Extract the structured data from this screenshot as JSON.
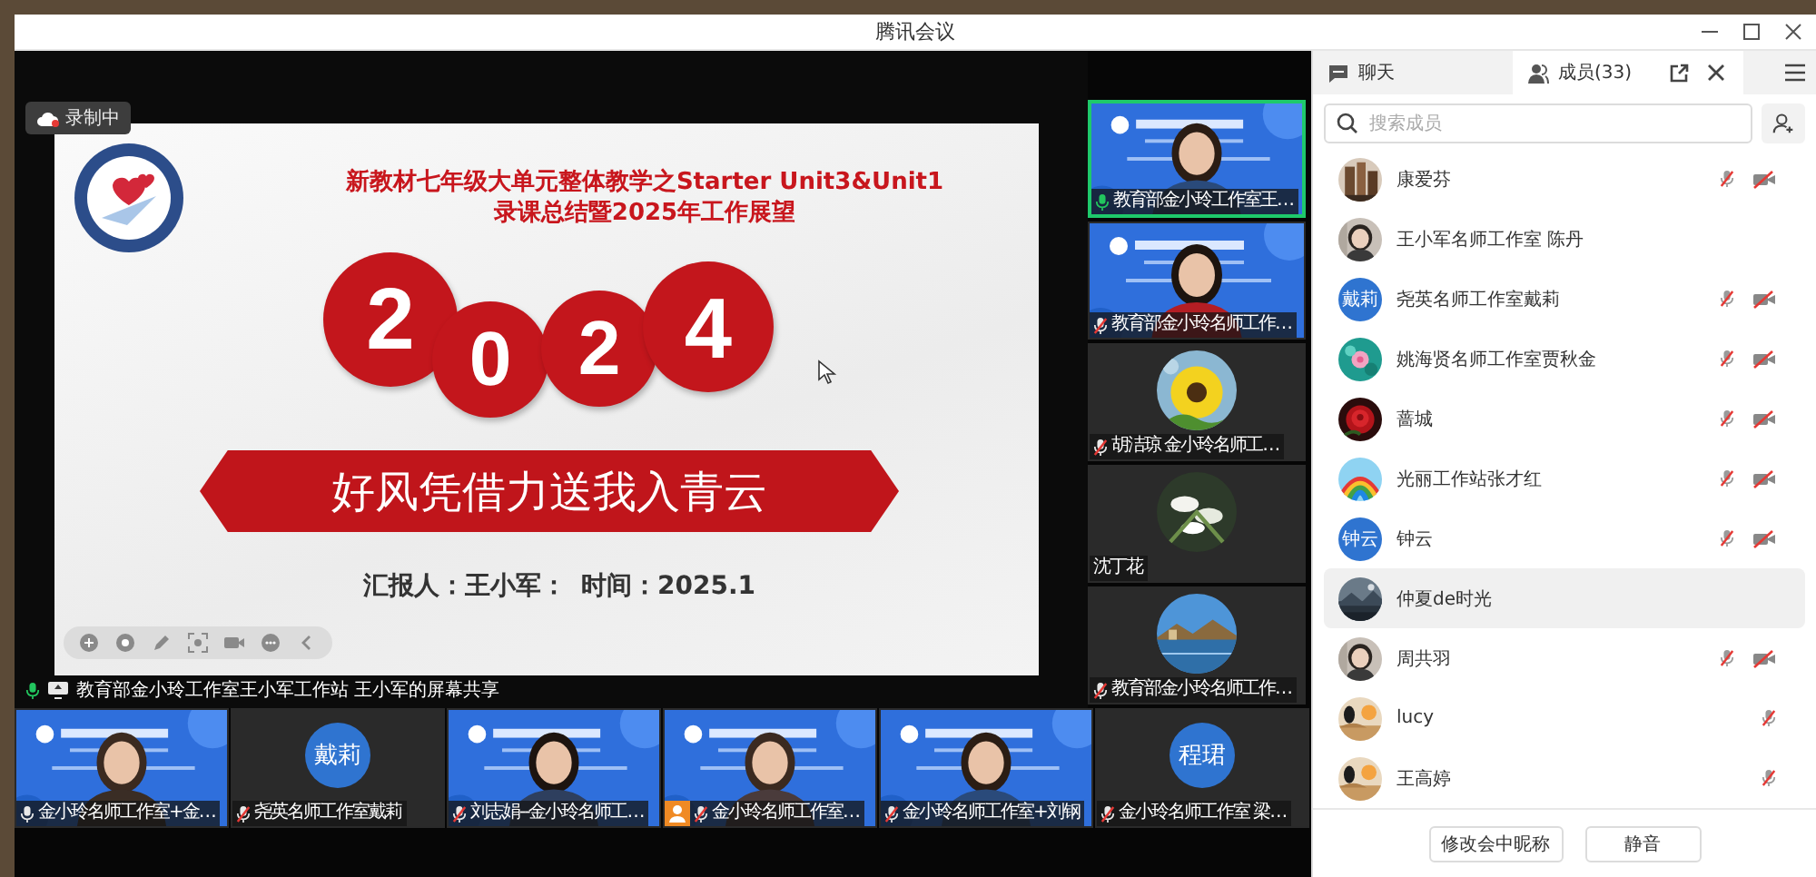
{
  "window": {
    "title": "腾讯会议"
  },
  "recording_badge": {
    "label": "录制中"
  },
  "slide": {
    "title_lines": [
      "新教材七年级大单元整体教学之Starter Unit3&Unit1",
      "录课总结暨2025年工作展望"
    ],
    "year_digits": [
      "2",
      "0",
      "2",
      "4"
    ],
    "banner": "好风凭借力送我入青云",
    "reporter": "汇报人：王小军：",
    "time": "时间：2025.1"
  },
  "share_caption": "教育部金小玲工作室王小军工作站 王小军的屏幕共享",
  "side_tiles": [
    {
      "kind": "video",
      "name": "教育部金小玲工作室王…",
      "has_mic": true,
      "mic_muted": false,
      "active": true,
      "host": false
    },
    {
      "kind": "video",
      "name": "教育部金小玲名师工作…",
      "has_mic": true,
      "mic_muted": true,
      "active": false,
      "host": false
    },
    {
      "kind": "avatar_picture",
      "name": "胡洁琼 金小玲名师工…",
      "has_mic": true,
      "mic_muted": true,
      "active": false,
      "host": false
    },
    {
      "kind": "avatar_picture",
      "name": "沈丁花",
      "has_mic": false,
      "active": false,
      "host": false
    },
    {
      "kind": "avatar_picture",
      "name": "教育部金小玲名师工作…",
      "has_mic": true,
      "mic_muted": true,
      "active": false,
      "host": false
    }
  ],
  "bottom_tiles": [
    {
      "kind": "video",
      "name": "金小玲名师工作室+金…",
      "has_mic": true,
      "mic_muted": false,
      "active": false,
      "host": false
    },
    {
      "kind": "avatar_text",
      "avatar_text": "戴莉",
      "name": "尧英名师工作室戴莉",
      "has_mic": true,
      "mic_muted": true,
      "active": false,
      "host": false
    },
    {
      "kind": "video",
      "name": "刘志娟--金小玲名师工…",
      "has_mic": true,
      "mic_muted": true,
      "active": false,
      "host": false
    },
    {
      "kind": "video",
      "name": "金小玲名师工作室…",
      "has_mic": true,
      "mic_muted": true,
      "active": false,
      "host": true
    },
    {
      "kind": "video",
      "name": "金小玲名师工作室+刘钢",
      "has_mic": true,
      "mic_muted": true,
      "active": false,
      "host": false
    },
    {
      "kind": "avatar_text",
      "avatar_text": "程珺",
      "name": "金小玲名师工作室 梁…",
      "has_mic": true,
      "mic_muted": true,
      "active": false,
      "host": false
    }
  ],
  "panel": {
    "tabs": [
      {
        "label": "聊天",
        "selected": false
      },
      {
        "label": "成员(33)",
        "selected": true
      }
    ],
    "search": {
      "placeholder": "搜索成员"
    },
    "members": [
      {
        "kind": "picture",
        "name": "康爱芬",
        "mic_muted": true,
        "camera_off": true,
        "selected": false
      },
      {
        "kind": "picture",
        "name": "王小军名师工作室 陈丹",
        "mic_muted": false,
        "camera_off": false,
        "selected": false
      },
      {
        "kind": "text",
        "avatar_text": "戴莉",
        "name": "尧英名师工作室戴莉",
        "mic_muted": true,
        "camera_off": true,
        "selected": false
      },
      {
        "kind": "picture",
        "name": "姚海贤名师工作室贾秋金",
        "mic_muted": true,
        "camera_off": true,
        "selected": false
      },
      {
        "kind": "picture",
        "name": "蔷城",
        "mic_muted": true,
        "camera_off": true,
        "selected": false
      },
      {
        "kind": "picture",
        "name": "光丽工作站张才红",
        "mic_muted": true,
        "camera_off": true,
        "selected": false
      },
      {
        "kind": "text",
        "avatar_text": "钟云",
        "name": "钟云",
        "mic_muted": true,
        "camera_off": true,
        "selected": false
      },
      {
        "kind": "picture",
        "name": "仲夏de时光",
        "mic_muted": false,
        "camera_off": false,
        "selected": true
      },
      {
        "kind": "picture",
        "name": "周共羽",
        "mic_muted": true,
        "camera_off": true,
        "selected": false
      },
      {
        "kind": "picture",
        "name": "lucy",
        "mic_muted": true,
        "camera_off": false,
        "selected": false
      },
      {
        "kind": "picture",
        "name": "王高婷",
        "mic_muted": true,
        "camera_off": false,
        "selected": false
      }
    ],
    "buttons": [
      "修改会中昵称",
      "静音"
    ]
  }
}
